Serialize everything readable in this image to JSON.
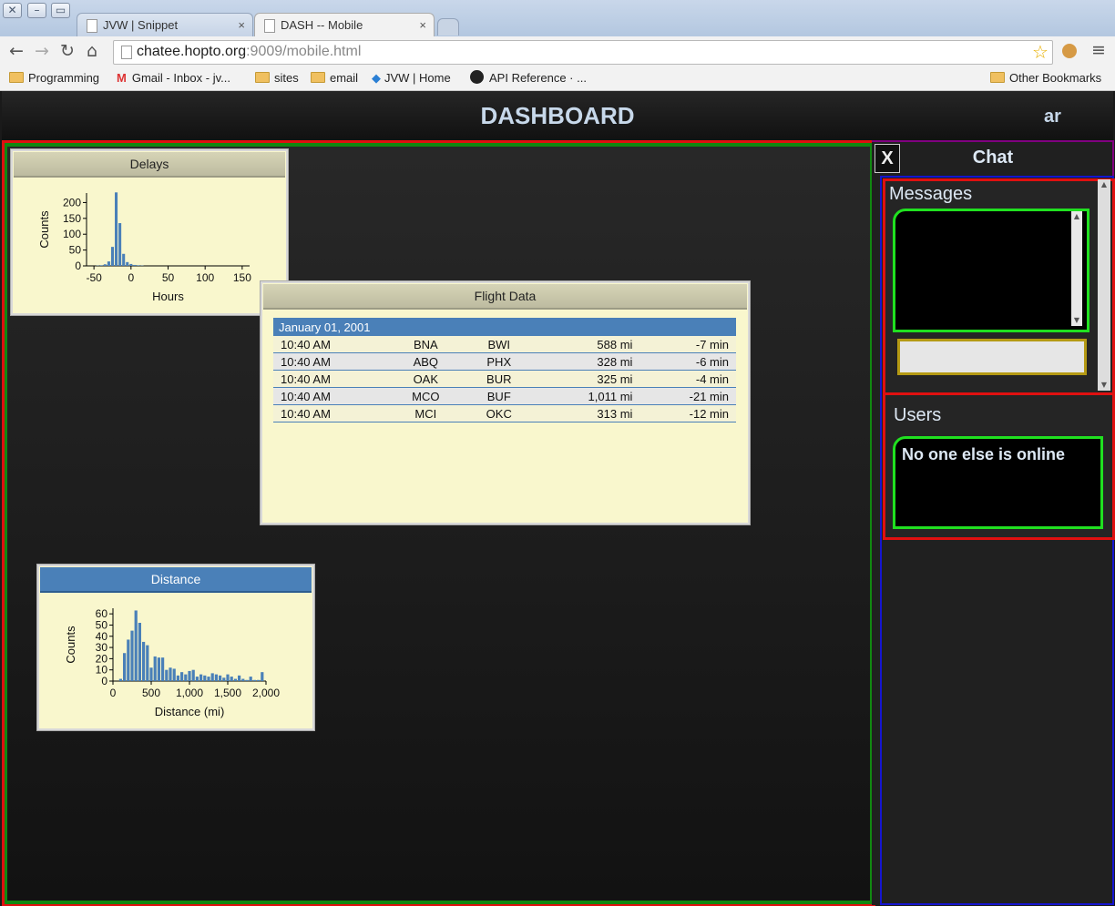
{
  "browser": {
    "tabs": [
      {
        "label": "JVW | Snippet",
        "close": "×"
      },
      {
        "label": "DASH -- Mobile",
        "close": "×"
      }
    ],
    "url": {
      "host": "chatee.hopto.org",
      "rest": ":9009/mobile.html"
    },
    "bookmarks": [
      {
        "label": "Programming",
        "icon": "folder-icon"
      },
      {
        "label": "Gmail - Inbox - jv...",
        "icon": "gmail-icon"
      },
      {
        "label": "sites",
        "icon": "folder-icon"
      },
      {
        "label": "email",
        "icon": "folder-icon"
      },
      {
        "label": "JVW | Home",
        "icon": "jvw-icon"
      },
      {
        "label": "API Reference · ...",
        "icon": "github-icon"
      }
    ],
    "other_bookmarks": "Other Bookmarks"
  },
  "app": {
    "title": "DASHBOARD",
    "user": "ar",
    "colors": {
      "frame": "#e01010",
      "inner": "#118811",
      "chat_outline": "#1515d0",
      "highlight": "#20e020",
      "accent": "#4a80b8"
    }
  },
  "widgets": {
    "delays": {
      "title": "Delays"
    },
    "flight": {
      "title": "Flight Data",
      "date": "January 01, 2001",
      "rows": [
        {
          "time": "10:40 AM",
          "origin": "BNA",
          "dest": "BWI",
          "distance": "588 mi",
          "delay": "-7 min"
        },
        {
          "time": "10:40 AM",
          "origin": "ABQ",
          "dest": "PHX",
          "distance": "328 mi",
          "delay": "-6 min"
        },
        {
          "time": "10:40 AM",
          "origin": "OAK",
          "dest": "BUR",
          "distance": "325 mi",
          "delay": "-4 min"
        },
        {
          "time": "10:40 AM",
          "origin": "MCO",
          "dest": "BUF",
          "distance": "1,011 mi",
          "delay": "-21 min"
        },
        {
          "time": "10:40 AM",
          "origin": "MCI",
          "dest": "OKC",
          "distance": "313 mi",
          "delay": "-12 min"
        }
      ]
    },
    "distance": {
      "title": "Distance"
    }
  },
  "chat": {
    "close": "X",
    "title": "Chat",
    "messages_label": "Messages",
    "users_label": "Users",
    "users_empty": "No one else is online"
  },
  "chart_data": [
    {
      "type": "bar",
      "title": "Delays",
      "xlabel": "Hours",
      "ylabel": "Counts",
      "xlim": [
        -60,
        160
      ],
      "ylim": [
        0,
        230
      ],
      "xticks": [
        "-50",
        "0",
        "50",
        "100",
        "150"
      ],
      "yticks": [
        "0",
        "50",
        "100",
        "150",
        "200"
      ],
      "bin_width": 5,
      "bins": [
        {
          "x": -45,
          "y": 1
        },
        {
          "x": -40,
          "y": 2
        },
        {
          "x": -35,
          "y": 5
        },
        {
          "x": -30,
          "y": 14
        },
        {
          "x": -25,
          "y": 60
        },
        {
          "x": -20,
          "y": 232
        },
        {
          "x": -15,
          "y": 135
        },
        {
          "x": -10,
          "y": 38
        },
        {
          "x": -5,
          "y": 12
        },
        {
          "x": 0,
          "y": 6
        },
        {
          "x": 5,
          "y": 3
        },
        {
          "x": 10,
          "y": 2
        },
        {
          "x": 15,
          "y": 1
        }
      ]
    },
    {
      "type": "bar",
      "title": "Distance",
      "xlabel": "Distance (mi)",
      "ylabel": "Counts",
      "xlim": [
        0,
        2000
      ],
      "ylim": [
        0,
        65
      ],
      "xticks": [
        "0",
        "500",
        "1,000",
        "1,500",
        "2,000"
      ],
      "yticks": [
        "0",
        "10",
        "20",
        "30",
        "40",
        "50",
        "60"
      ],
      "bin_width": 50,
      "bins": [
        {
          "x": 50,
          "y": 0
        },
        {
          "x": 100,
          "y": 2
        },
        {
          "x": 150,
          "y": 25
        },
        {
          "x": 200,
          "y": 37
        },
        {
          "x": 250,
          "y": 45
        },
        {
          "x": 300,
          "y": 63
        },
        {
          "x": 350,
          "y": 52
        },
        {
          "x": 400,
          "y": 35
        },
        {
          "x": 450,
          "y": 32
        },
        {
          "x": 500,
          "y": 12
        },
        {
          "x": 550,
          "y": 22
        },
        {
          "x": 600,
          "y": 21
        },
        {
          "x": 650,
          "y": 21
        },
        {
          "x": 700,
          "y": 10
        },
        {
          "x": 750,
          "y": 12
        },
        {
          "x": 800,
          "y": 11
        },
        {
          "x": 850,
          "y": 5
        },
        {
          "x": 900,
          "y": 8
        },
        {
          "x": 950,
          "y": 6
        },
        {
          "x": 1000,
          "y": 9
        },
        {
          "x": 1050,
          "y": 10
        },
        {
          "x": 1100,
          "y": 4
        },
        {
          "x": 1150,
          "y": 6
        },
        {
          "x": 1200,
          "y": 5
        },
        {
          "x": 1250,
          "y": 4
        },
        {
          "x": 1300,
          "y": 7
        },
        {
          "x": 1350,
          "y": 6
        },
        {
          "x": 1400,
          "y": 5
        },
        {
          "x": 1450,
          "y": 3
        },
        {
          "x": 1500,
          "y": 6
        },
        {
          "x": 1550,
          "y": 4
        },
        {
          "x": 1600,
          "y": 2
        },
        {
          "x": 1650,
          "y": 5
        },
        {
          "x": 1700,
          "y": 2
        },
        {
          "x": 1750,
          "y": 1
        },
        {
          "x": 1800,
          "y": 4
        },
        {
          "x": 1850,
          "y": 1
        },
        {
          "x": 1900,
          "y": 1
        },
        {
          "x": 1950,
          "y": 8
        }
      ]
    }
  ]
}
